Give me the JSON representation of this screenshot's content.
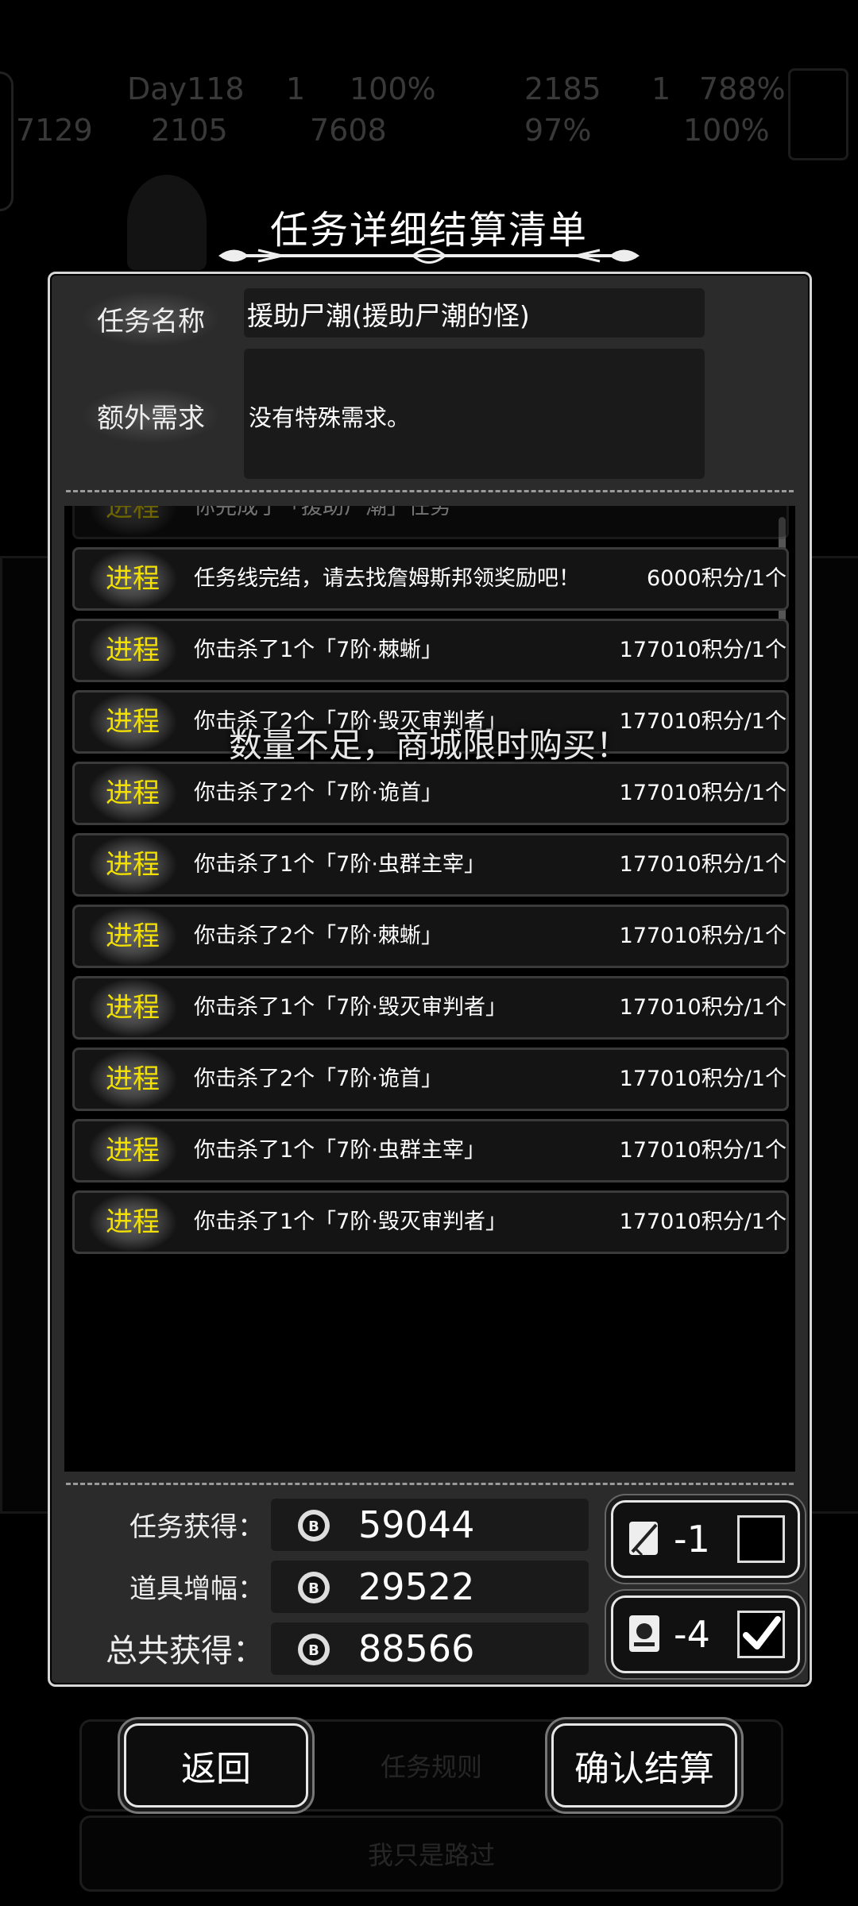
{
  "background": {
    "day": "Day118",
    "stats_top": [
      "1",
      "100%",
      "2185",
      "1",
      "788%"
    ],
    "stats_bottom": [
      "7129",
      "2105",
      "7608",
      "97%",
      "100%"
    ],
    "buttons": [
      "任务规则",
      "我只是路过"
    ]
  },
  "dialog": {
    "title": "任务详细结算清单",
    "task_name_label": "任务名称",
    "task_name_value": "援助尸潮(援助尸潮的怪)",
    "extra_label": "额外需求",
    "extra_value": "没有特殊需求。",
    "toast": "数量不足，商城限时购买！",
    "log": [
      {
        "tag": "进程",
        "text": "你完成了「援助尸潮」任务",
        "reward": ""
      },
      {
        "tag": "进程",
        "text": "任务线完结，请去找詹姆斯邦领奖励吧！",
        "reward": "6000积分/1个"
      },
      {
        "tag": "进程",
        "text": "你击杀了1个「7阶·棘蜥」",
        "reward": "177010积分/1个"
      },
      {
        "tag": "进程",
        "text": "你击杀了2个「7阶·毁灭审判者」",
        "reward": "177010积分/1个"
      },
      {
        "tag": "进程",
        "text": "你击杀了2个「7阶·诡首」",
        "reward": "177010积分/1个"
      },
      {
        "tag": "进程",
        "text": "你击杀了1个「7阶·虫群主宰」",
        "reward": "177010积分/1个"
      },
      {
        "tag": "进程",
        "text": "你击杀了2个「7阶·棘蜥」",
        "reward": "177010积分/1个"
      },
      {
        "tag": "进程",
        "text": "你击杀了1个「7阶·毁灭审判者」",
        "reward": "177010积分/1个"
      },
      {
        "tag": "进程",
        "text": "你击杀了2个「7阶·诡首」",
        "reward": "177010积分/1个"
      },
      {
        "tag": "进程",
        "text": "你击杀了1个「7阶·虫群主宰」",
        "reward": "177010积分/1个"
      },
      {
        "tag": "进程",
        "text": "你击杀了1个「7阶·毁灭审判者」",
        "reward": "177010积分/1个"
      }
    ],
    "summary": {
      "task_label": "任务获得：",
      "task_value": "59044",
      "item_label": "道具增幅：",
      "item_value": "29522",
      "total_label": "总共获得：",
      "total_value": "88566"
    },
    "items": [
      {
        "count": "-1",
        "checked": false,
        "icon": "scroll-quill-icon"
      },
      {
        "count": "-4",
        "checked": true,
        "icon": "scroll-seal-icon"
      }
    ],
    "buttons": {
      "back": "返回",
      "confirm": "确认结算"
    }
  }
}
